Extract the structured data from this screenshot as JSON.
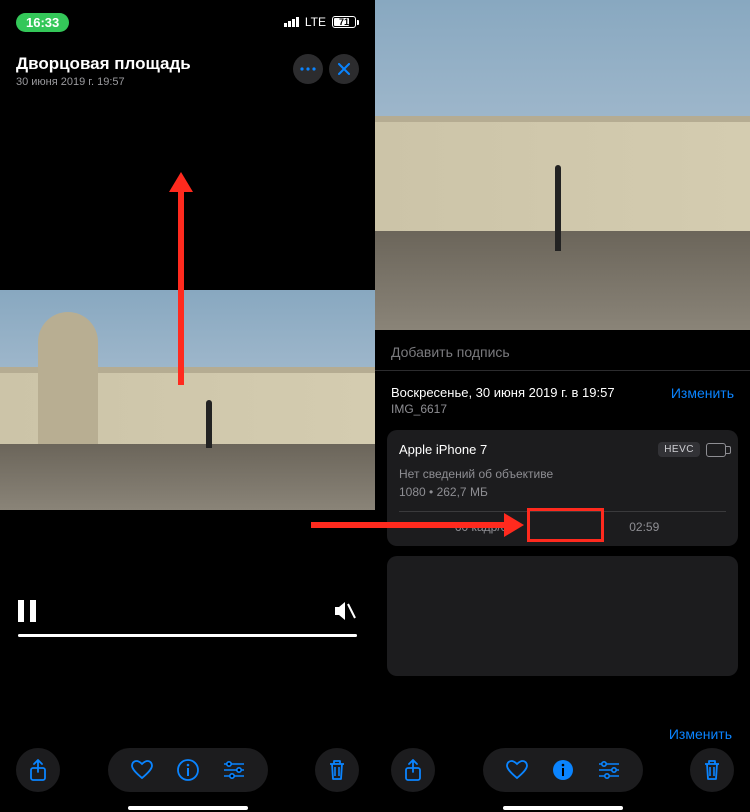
{
  "statusbar": {
    "time": "16:33",
    "network": "LTE",
    "battery": "71"
  },
  "left": {
    "title": "Дворцовая площадь",
    "subtitle": "30 июня 2019 г.  19:57"
  },
  "right": {
    "caption_placeholder": "Добавить подпись",
    "date": "Воскресенье, 30 июня 2019 г. в 19:57",
    "filename": "IMG_6617",
    "edit": "Изменить",
    "device": "Apple iPhone 7",
    "codec": "HEVC",
    "lens_line": "Нет сведений об объективе",
    "res_line_prefix": "1080",
    "size": "262,7 МБ",
    "fps": "60 кадр/с",
    "duration": "02:59",
    "edit2": "Изменить"
  }
}
